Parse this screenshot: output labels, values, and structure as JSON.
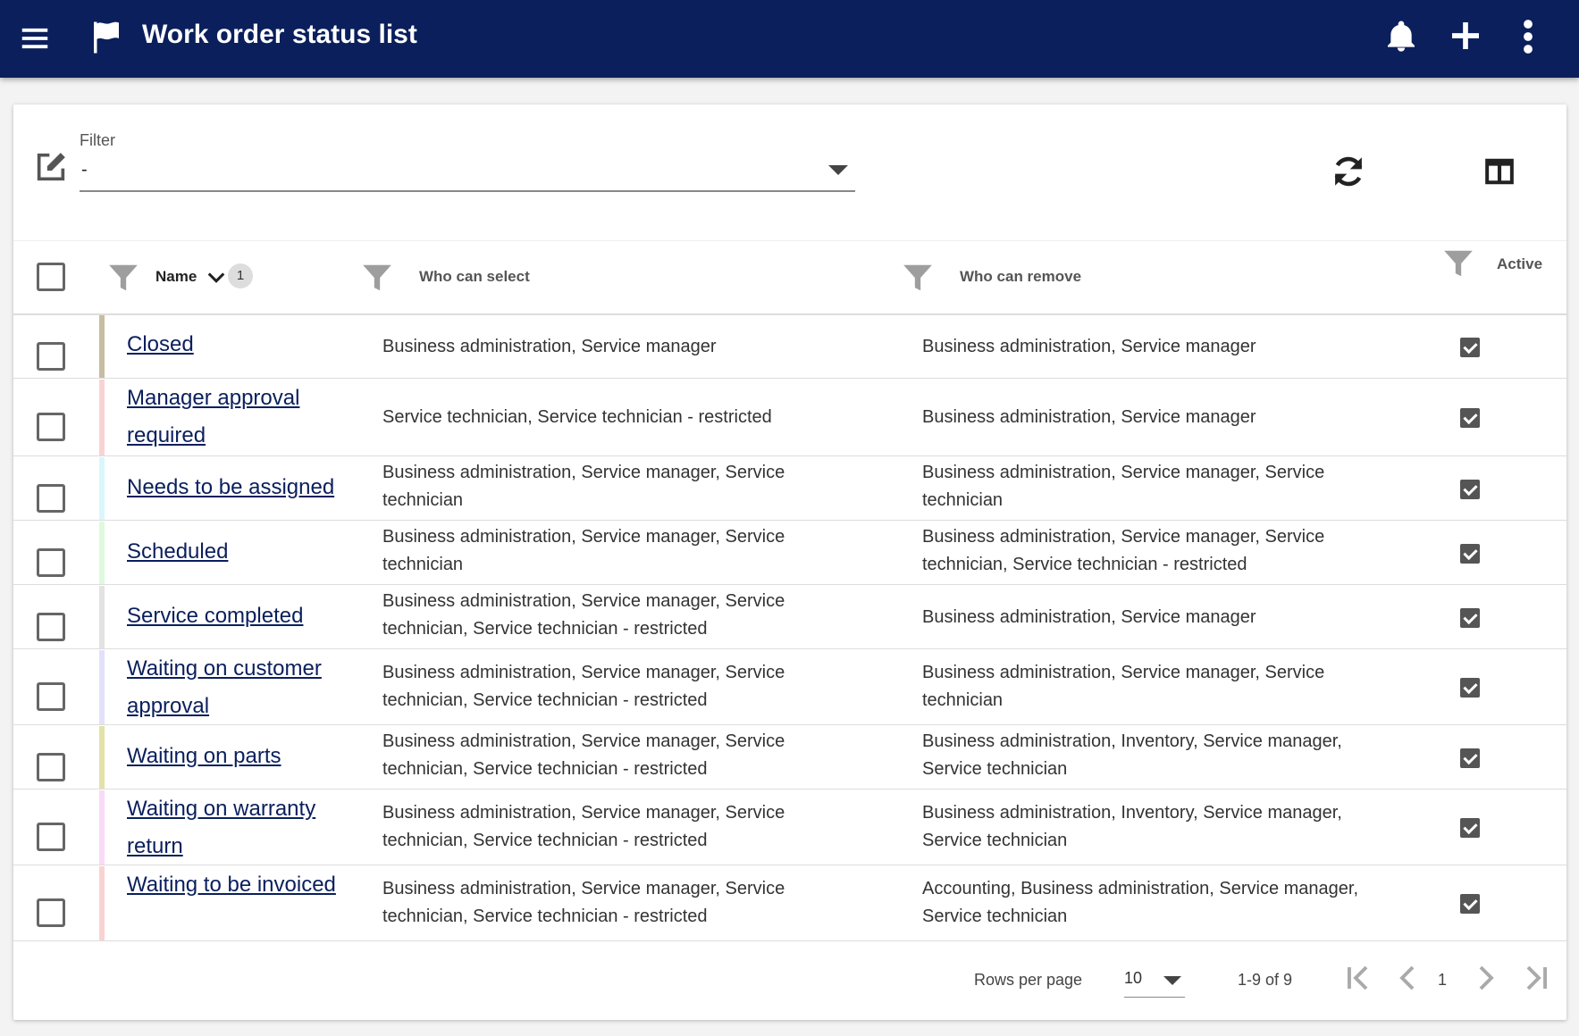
{
  "appbar": {
    "title": "Work order status list",
    "icons": [
      "menu-icon",
      "flag-icon",
      "bell-icon",
      "plus-icon",
      "more-vert-icon"
    ],
    "bg": "#0a1f5c"
  },
  "filter": {
    "label": "Filter",
    "value": "-"
  },
  "table": {
    "headers": {
      "name": "Name",
      "who_select": "Who can select",
      "who_remove": "Who can remove",
      "active": "Active"
    },
    "sort_order": "1",
    "rows": [
      {
        "name": "Closed",
        "color": "#c7bda0",
        "select": "Business administration, Service manager",
        "remove": "Business administration, Service manager",
        "active": true
      },
      {
        "name": "Manager approval required",
        "color": "#f9d3d3",
        "select": "Service technician, Service technician - restricted",
        "remove": "Business administration, Service manager",
        "active": true
      },
      {
        "name": "Needs to be assigned",
        "color": "#d9f7fb",
        "select": "Business administration, Service manager, Service technician",
        "remove": "Business administration, Service manager, Service technician",
        "active": true
      },
      {
        "name": "Scheduled",
        "color": "#dff9df",
        "select": "Business administration, Service manager, Service technician",
        "remove": "Business administration, Service manager, Service technician, Service technician - restricted",
        "active": true
      },
      {
        "name": "Service completed",
        "color": "#e3e3e3",
        "select": "Business administration, Service manager, Service technician, Service technician - restricted",
        "remove": "Business administration, Service manager",
        "active": true
      },
      {
        "name": "Waiting on customer approval",
        "color": "#e3e1fa",
        "select": "Business administration, Service manager, Service technician, Service technician - restricted",
        "remove": "Business administration, Service manager, Service technician",
        "active": true
      },
      {
        "name": "Waiting on parts",
        "color": "#e3e2a8",
        "select": "Business administration, Service manager, Service technician, Service technician - restricted",
        "remove": "Business administration, Inventory, Service manager, Service technician",
        "active": true
      },
      {
        "name": "Waiting on warranty return",
        "color": "#f9daf9",
        "select": "Business administration, Service manager, Service technician, Service technician - restricted",
        "remove": "Business administration, Inventory, Service manager, Service technician",
        "active": true
      },
      {
        "name": "Waiting to be invoiced",
        "color": "#f9d3d3",
        "select": "Business administration, Service manager, Service technician, Service technician - restricted",
        "remove": "Accounting, Business administration, Service manager, Service technician",
        "active": true
      }
    ]
  },
  "footer": {
    "rows_per_page_label": "Rows per page",
    "rows_per_page": "10",
    "range": "1-9 of 9",
    "page": "1"
  }
}
